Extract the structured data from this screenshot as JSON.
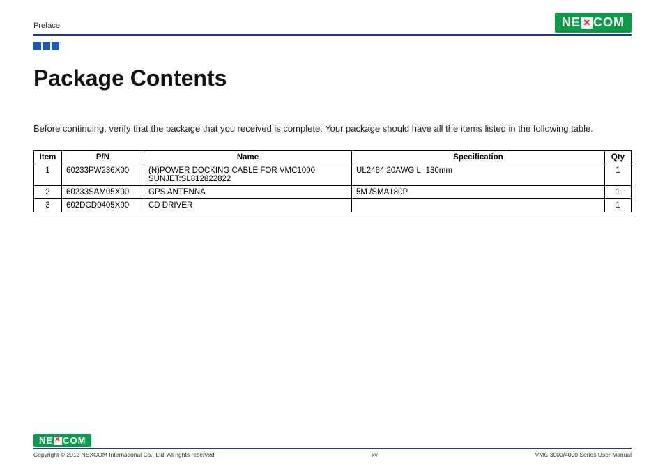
{
  "header": {
    "section": "Preface",
    "logo_text_left": "NE",
    "logo_text_right": "COM"
  },
  "title": "Package Contents",
  "intro": "Before continuing, verify that the package that you received is complete. Your package should have all the items listed in the following table.",
  "table": {
    "headers": {
      "item": "Item",
      "pn": "P/N",
      "name": "Name",
      "spec": "Specification",
      "qty": "Qty"
    },
    "rows": [
      {
        "item": "1",
        "pn": "60233PW236X00",
        "name": "(N)POWER DOCKING CABLE FOR VMC1000 SUNJET:SL812822822",
        "spec": "UL2464 20AWG L=130mm",
        "qty": "1"
      },
      {
        "item": "2",
        "pn": "60233SAM05X00",
        "name": "GPS ANTENNA",
        "spec": "5M /SMA180P",
        "qty": "1"
      },
      {
        "item": "3",
        "pn": "602DCD0405X00",
        "name": "CD DRIVER",
        "spec": "",
        "qty": "1"
      }
    ]
  },
  "footer": {
    "copyright": "Copyright © 2012 NEXCOM International Co., Ltd. All rights reserved",
    "page_num": "xv",
    "doc": "VMC 3000/4000 Series User Manual"
  }
}
